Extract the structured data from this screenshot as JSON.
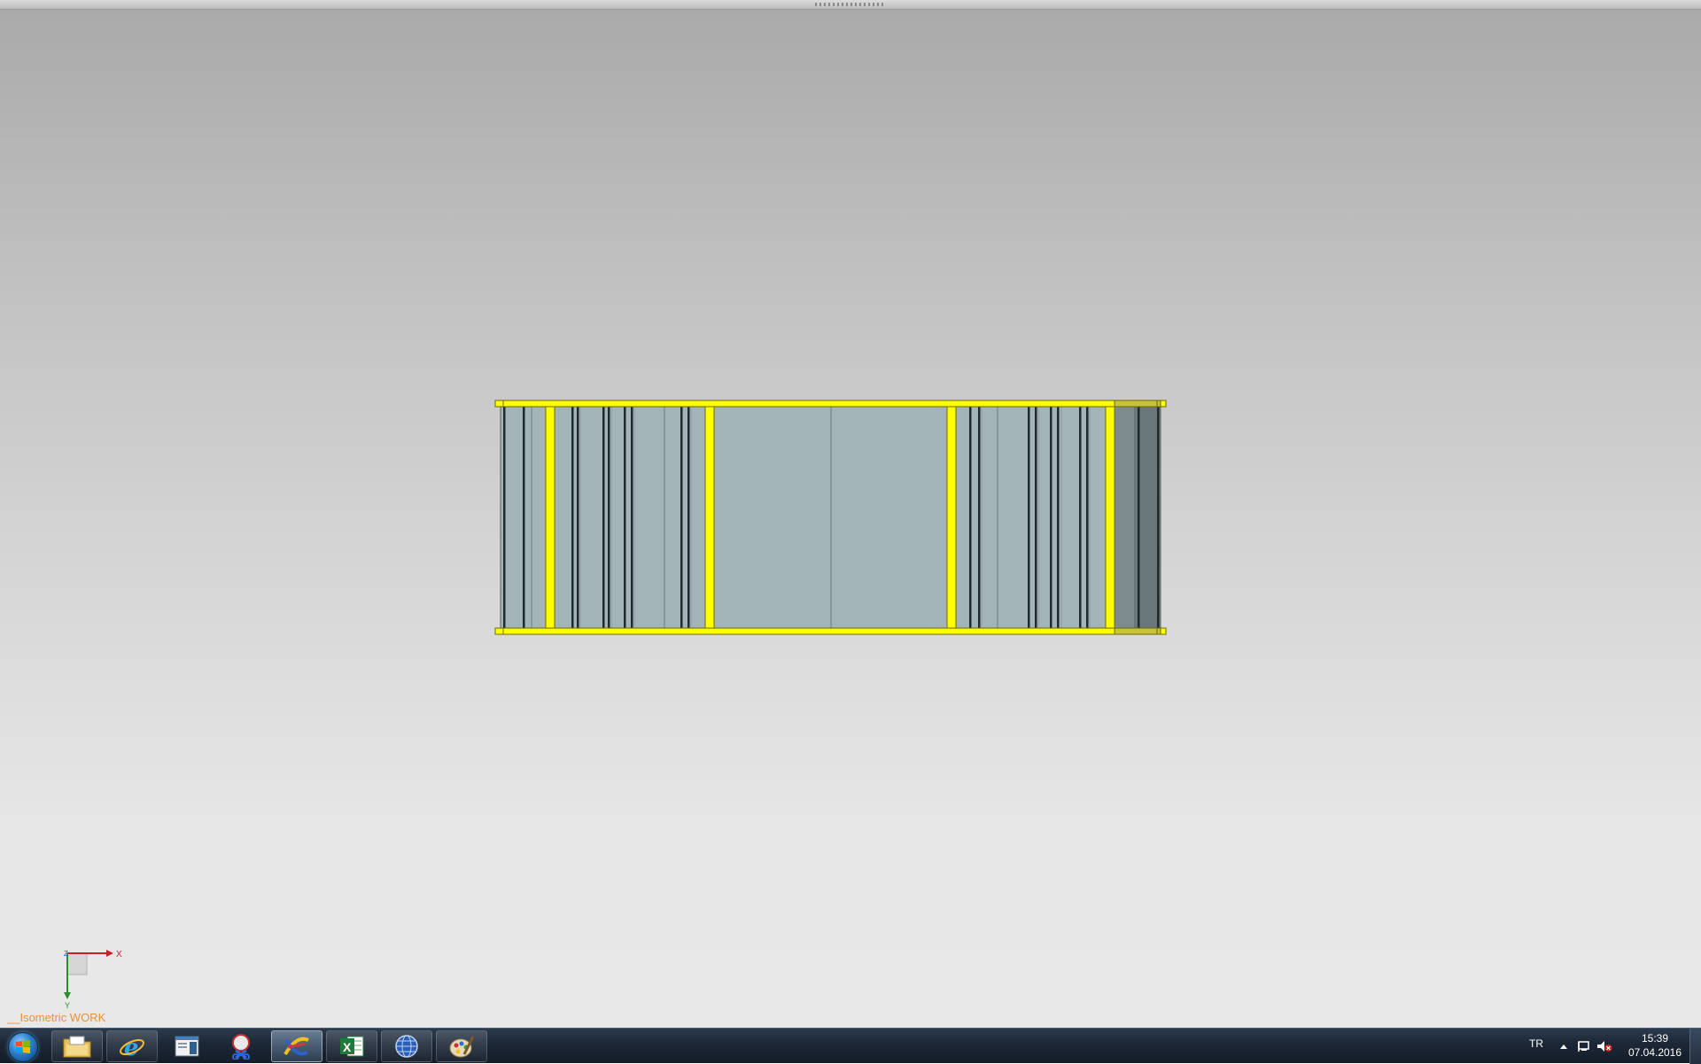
{
  "viewport": {
    "view_label": "__Isometric WORK",
    "triad": {
      "x_label": "X",
      "y_label": "Y",
      "z_label": "Z"
    },
    "model": {
      "frame_color": "#ffff00",
      "panel_color": "#a3b4b9",
      "dark_color": "#1f2a2d"
    }
  },
  "taskbar": {
    "start_icon": "windows-start-icon",
    "apps": [
      {
        "name": "explorer-icon"
      },
      {
        "name": "internet-explorer-icon"
      },
      {
        "name": "window-app-icon"
      },
      {
        "name": "snipping-tool-icon"
      },
      {
        "name": "cad-app-icon"
      },
      {
        "name": "excel-icon"
      },
      {
        "name": "globe-app-icon"
      },
      {
        "name": "paint-icon"
      }
    ],
    "tray": {
      "language": "TR",
      "time": "15:39",
      "date": "07.04.2016"
    }
  }
}
